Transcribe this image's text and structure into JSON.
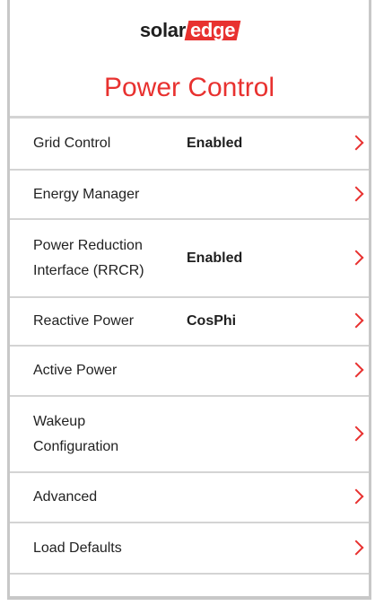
{
  "brand": {
    "solar": "solar",
    "edge": "edge"
  },
  "title": "Power Control",
  "items": [
    {
      "label": "Grid Control",
      "value": "Enabled"
    },
    {
      "label": "Energy Manager",
      "value": ""
    },
    {
      "label": "Power Reduction Interface (RRCR)",
      "value": "Enabled"
    },
    {
      "label": "Reactive Power",
      "value": "CosPhi"
    },
    {
      "label": "Active Power",
      "value": ""
    },
    {
      "label": "Wakeup Configuration",
      "value": ""
    },
    {
      "label": "Advanced",
      "value": ""
    },
    {
      "label": "Load Defaults",
      "value": ""
    }
  ],
  "icons": {
    "row_arrow": "chevron-right-icon"
  },
  "colors": {
    "accent": "#e8312f",
    "divider": "#d4d4d4"
  }
}
